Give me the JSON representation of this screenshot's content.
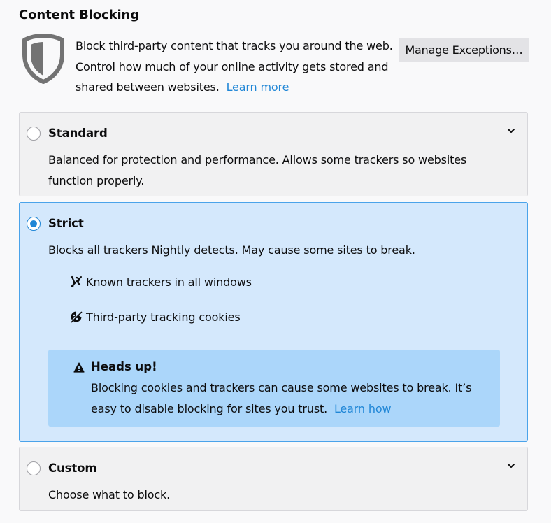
{
  "section": {
    "title": "Content Blocking"
  },
  "intro": {
    "line1": "Block third-party content that tracks you around the web.",
    "line2": "Control how much of your online activity gets stored and",
    "line3": "shared between websites.",
    "learn_more": "Learn more",
    "icon": "shield-icon"
  },
  "manage_exceptions_label": "Manage Exceptions…",
  "options": {
    "standard": {
      "title": "Standard",
      "description": "Balanced for protection and performance. Allows some trackers so websites function properly.",
      "selected": false
    },
    "strict": {
      "title": "Strict",
      "description": "Blocks all trackers Nightly detects. May cause some sites to break.",
      "selected": true,
      "features": [
        {
          "icon": "tracker-icon",
          "label": "Known trackers in all windows"
        },
        {
          "icon": "cookie-icon",
          "label": "Third-party tracking cookies"
        }
      ],
      "warning": {
        "icon": "warning-icon",
        "title": "Heads up!",
        "line1": "Blocking cookies and trackers can cause some websites to break. It’s",
        "line2": "easy to disable blocking for sites you trust.",
        "link": "Learn how"
      }
    },
    "custom": {
      "title": "Custom",
      "description": "Choose what to block.",
      "selected": false
    }
  },
  "colors": {
    "accent": "#1f86d6",
    "selected_bg": "#d4e8fc",
    "warning_bg": "#abd6fa",
    "button_bg": "#e3e3e6"
  }
}
